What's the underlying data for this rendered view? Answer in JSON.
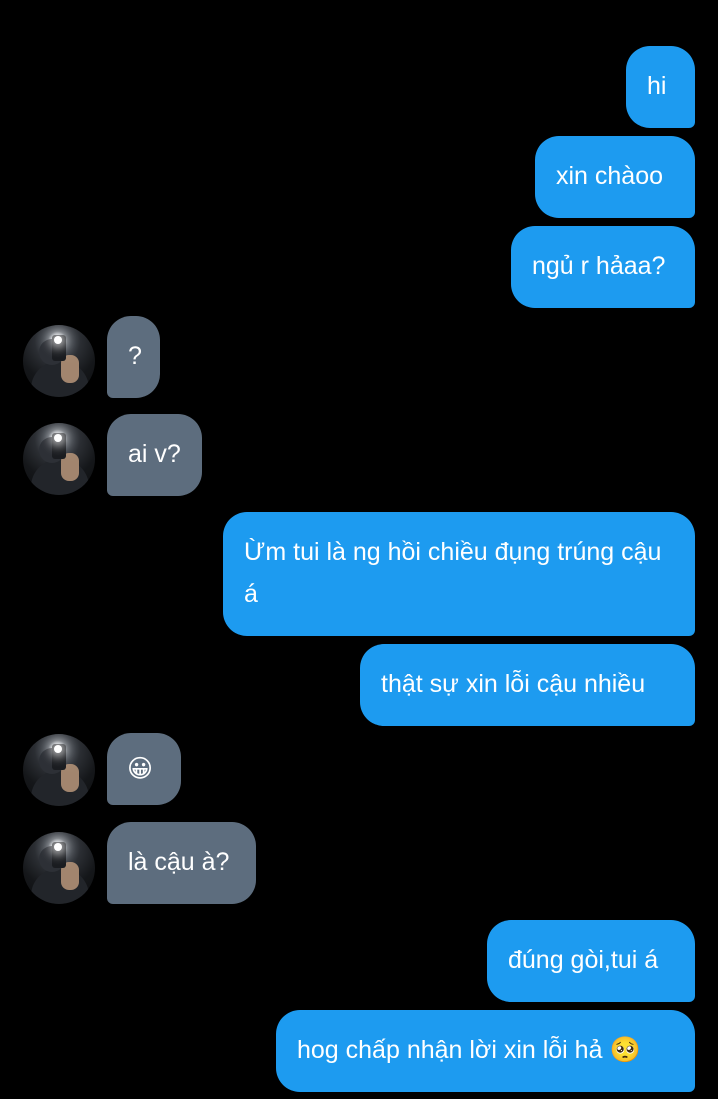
{
  "conversation": {
    "messages": [
      {
        "from": "me",
        "text": "hi"
      },
      {
        "from": "me",
        "text": "xin chàoo"
      },
      {
        "from": "me",
        "text": "ngủ r hảaa?"
      },
      {
        "from": "them",
        "text": "?"
      },
      {
        "from": "them",
        "text": "ai v?"
      },
      {
        "from": "me",
        "text": "Ừm tui là ng hồi chiều đụng trúng cậu á"
      },
      {
        "from": "me",
        "text": "thật sự xin lỗi cậu nhiều"
      },
      {
        "from": "them",
        "text": "😀"
      },
      {
        "from": "them",
        "text": "là cậu à?"
      },
      {
        "from": "me",
        "text": "đúng gòi,tui á"
      },
      {
        "from": "me",
        "text": "hog chấp nhận lời xin lỗi hả 🥺"
      }
    ]
  },
  "colors": {
    "background": "#000000",
    "sent_bubble": "#1d9bf0",
    "received_bubble": "#5d6d7e",
    "text": "#ffffff"
  }
}
